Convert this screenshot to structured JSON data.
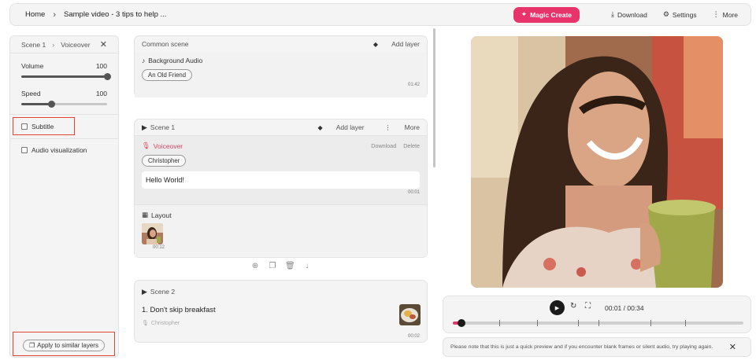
{
  "breadcrumb": {
    "home": "Home",
    "separator": "›",
    "current": "Sample video - 3 tips to help ..."
  },
  "toolbar": {
    "magic_create": "Magic Create",
    "download": "Download",
    "settings": "Settings",
    "more": "More",
    "accent_color": "#e8336b"
  },
  "left_panel": {
    "breadcrumb_scene": "Scene 1",
    "breadcrumb_layer": "Voiceover",
    "close_glyph": "✕",
    "volume_label": "Volume",
    "volume_value": "100",
    "volume_level": 1.0,
    "speed_label": "Speed",
    "speed_value": "100",
    "speed_level": 0.35,
    "subtitle_label": "Subtitle",
    "audio_viz_label": "Audio visualization",
    "apply_label": "Apply to similar layers"
  },
  "common_scene": {
    "title": "Common scene",
    "add_layer": "Add layer",
    "bg_audio_label": "Background Audio",
    "bg_audio_track": "An Old Friend",
    "duration": "01:42"
  },
  "scene1": {
    "title": "Scene 1",
    "add_layer": "Add layer",
    "more": "More",
    "voiceover_label": "Voiceover",
    "download": "Download",
    "delete": "Delete",
    "voice": "Christopher",
    "text": "Hello World!",
    "text_time": "00:01",
    "layout_label": "Layout",
    "layout_time": "00:12"
  },
  "scene2": {
    "title": "Scene 2",
    "text": "1. Don't skip breakfast",
    "voice": "Christopher",
    "time": "00:02"
  },
  "player": {
    "timecode": "00:01 / 00:34",
    "progress": 0.03,
    "markers": [
      0.03,
      0.16,
      0.29,
      0.43,
      0.5,
      0.68,
      0.8
    ]
  },
  "notice": {
    "text": "Please note that this is just a quick preview and if you encounter blank frames or silent audio, try playing again.",
    "close_glyph": "✕"
  }
}
